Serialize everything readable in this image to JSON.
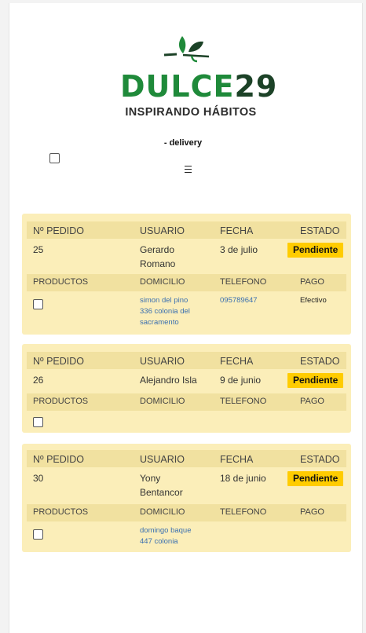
{
  "brand": {
    "name_part1": "DULCE",
    "name_part2": "29",
    "tagline": "INSPIRANDO HÁBITOS",
    "green": "#1f8a3a",
    "dark_green": "#1c4227"
  },
  "subtitle": "- delivery",
  "menu_icon": "hamburger-icon",
  "headers": {
    "pedido": "Nº PEDIDO",
    "usuario": "USUARIO",
    "fecha": "FECHA",
    "estado": "ESTADO",
    "productos": "PRODUCTOS",
    "domicilio": "DOMICILIO",
    "telefono": "TELEFONO",
    "pago": "PAGO"
  },
  "orders": [
    {
      "pedido": "25",
      "usuario_l1": "Gerardo",
      "usuario_l2": "Romano",
      "fecha": "3 de julio",
      "estado": "Pendiente",
      "domicilio_l1": "simon del pino",
      "domicilio_l2": "336 colonia del",
      "domicilio_l3": "sacramento",
      "telefono": "095789647",
      "pago": "Efectivo"
    },
    {
      "pedido": "26",
      "usuario_l1": "Alejandro Isla",
      "fecha": "9 de junio",
      "estado": "Pendiente"
    },
    {
      "pedido": "30",
      "usuario_l1": "Yony",
      "usuario_l2": "Bentancor",
      "fecha": "18 de junio",
      "estado": "Pendiente",
      "domicilio_l1": "domingo baque",
      "domicilio_l2": "447 colonia"
    }
  ],
  "colors": {
    "card_bg": "#fbeeb9",
    "header_bg": "#f1e1a0",
    "badge_bg": "#ffcc00",
    "link": "#3a6fb0"
  }
}
